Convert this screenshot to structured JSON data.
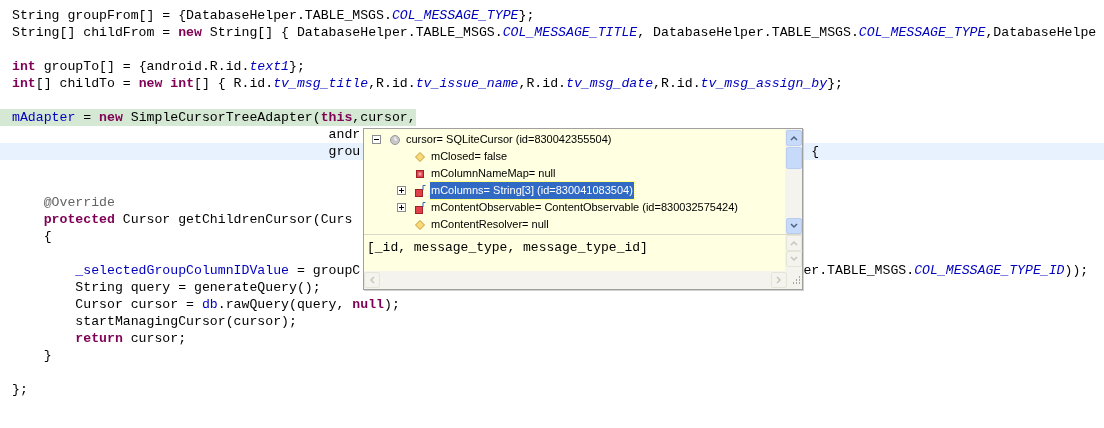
{
  "editor": {
    "lines": [
      {
        "kind": "code",
        "tokens": [
          {
            "text": "String groupFrom[] = {DatabaseHelper.TABLE_MSGS.",
            "kind": "plain"
          },
          {
            "text": "COL_MESSAGE_TYPE",
            "kind": "static"
          },
          {
            "text": "};",
            "kind": "plain"
          }
        ]
      },
      {
        "kind": "code",
        "tokens": [
          {
            "text": "String[] childFrom = ",
            "kind": "plain"
          },
          {
            "text": "new",
            "kind": "keyword"
          },
          {
            "text": " String[] { DatabaseHelper.TABLE_MSGS.",
            "kind": "plain"
          },
          {
            "text": "COL_MESSAGE_TITLE",
            "kind": "static"
          },
          {
            "text": ", DatabaseHelper.TABLE_MSGS.",
            "kind": "plain"
          },
          {
            "text": "COL_MESSAGE_TYPE",
            "kind": "static"
          },
          {
            "text": ",DatabaseHelpe",
            "kind": "plain"
          }
        ]
      },
      {
        "kind": "blank"
      },
      {
        "kind": "code",
        "tokens": [
          {
            "text": "int",
            "kind": "keyword"
          },
          {
            "text": " groupTo[] = {android.R.id.",
            "kind": "plain"
          },
          {
            "text": "text1",
            "kind": "static"
          },
          {
            "text": "};",
            "kind": "plain"
          }
        ]
      },
      {
        "kind": "code",
        "tokens": [
          {
            "text": "int",
            "kind": "keyword"
          },
          {
            "text": "[] childTo = ",
            "kind": "plain"
          },
          {
            "text": "new",
            "kind": "keyword"
          },
          {
            "text": " int",
            "kind": "keyword"
          },
          {
            "text": "[] { R.id.",
            "kind": "plain"
          },
          {
            "text": "tv_msg_title",
            "kind": "static"
          },
          {
            "text": ",R.id.",
            "kind": "plain"
          },
          {
            "text": "tv_issue_name",
            "kind": "static"
          },
          {
            "text": ",R.id.",
            "kind": "plain"
          },
          {
            "text": "tv_msg_date",
            "kind": "static"
          },
          {
            "text": ",R.id.",
            "kind": "plain"
          },
          {
            "text": "tv_msg_assign_by",
            "kind": "static"
          },
          {
            "text": "};",
            "kind": "plain"
          }
        ]
      },
      {
        "kind": "blank"
      },
      {
        "kind": "marked",
        "tokens": [
          {
            "text": "mAdapter",
            "kind": "field"
          },
          {
            "text": " = ",
            "kind": "plain"
          },
          {
            "text": "new",
            "kind": "keyword"
          },
          {
            "text": " SimpleCursorTreeAdapter(",
            "kind": "plain"
          },
          {
            "text": "this",
            "kind": "keyword"
          },
          {
            "text": ",cursor,",
            "kind": "plain"
          }
        ]
      },
      {
        "kind": "code",
        "tokens": [
          {
            "text": "                                        andr",
            "kind": "plain"
          }
        ]
      },
      {
        "kind": "current",
        "tokens": [
          {
            "text": "                                        grou",
            "kind": "plain"
          }
        ],
        "after": [
          {
            "text": " {",
            "kind": "plain"
          }
        ]
      },
      {
        "kind": "blank"
      },
      {
        "kind": "blank"
      },
      {
        "kind": "code",
        "tokens": [
          {
            "text": "    @Override",
            "kind": "annotation"
          }
        ]
      },
      {
        "kind": "code",
        "tokens": [
          {
            "text": "    protected",
            "kind": "keyword"
          },
          {
            "text": " Cursor getChildrenCursor(Curs",
            "kind": "plain"
          }
        ]
      },
      {
        "kind": "code",
        "tokens": [
          {
            "text": "    {",
            "kind": "plain"
          }
        ]
      },
      {
        "kind": "blank"
      },
      {
        "kind": "code",
        "tokens": [
          {
            "text": "        _selectedGroupColumnIDValue",
            "kind": "field"
          },
          {
            "text": " = groupC",
            "kind": "plain"
          }
        ],
        "after": [
          {
            "text": "er.TABLE_MSGS.",
            "kind": "plain"
          },
          {
            "text": "COL_MESSAGE_TYPE_ID",
            "kind": "static"
          },
          {
            "text": "));",
            "kind": "plain"
          }
        ]
      },
      {
        "kind": "code",
        "tokens": [
          {
            "text": "        String query = generateQuery();",
            "kind": "plain"
          }
        ]
      },
      {
        "kind": "code",
        "tokens": [
          {
            "text": "        Cursor cursor = ",
            "kind": "plain"
          },
          {
            "text": "db",
            "kind": "field"
          },
          {
            "text": ".rawQuery(query, ",
            "kind": "plain"
          },
          {
            "text": "null",
            "kind": "keyword"
          },
          {
            "text": ");",
            "kind": "plain"
          }
        ]
      },
      {
        "kind": "code",
        "tokens": [
          {
            "text": "        startManagingCursor(cursor);",
            "kind": "plain"
          }
        ]
      },
      {
        "kind": "code",
        "tokens": [
          {
            "text": "        return",
            "kind": "keyword"
          },
          {
            "text": " cursor;",
            "kind": "plain"
          }
        ]
      },
      {
        "kind": "code",
        "tokens": [
          {
            "text": "    }",
            "kind": "plain"
          }
        ]
      },
      {
        "kind": "blank"
      },
      {
        "kind": "code",
        "tokens": [
          {
            "text": "};",
            "kind": "plain"
          }
        ]
      }
    ]
  },
  "inspector": {
    "tree": [
      {
        "label": "cursor= SQLiteCursor  (id=830042355504)",
        "kind": "local",
        "expanded": true,
        "selected": false,
        "children": [
          {
            "label": "mClosed= false",
            "kind": "protected",
            "selected": false
          },
          {
            "label": "mColumnNameMap= null",
            "kind": "private",
            "selected": false
          },
          {
            "label": "mColumns= String[3]  (id=830041083504)",
            "kind": "private-final",
            "expanded": false,
            "selected": true
          },
          {
            "label": "mContentObservable= ContentObservable  (id=830032575424)",
            "kind": "private-final",
            "expanded": false,
            "selected": false
          },
          {
            "label": "mContentResolver= null",
            "kind": "protected",
            "selected": false
          }
        ]
      }
    ],
    "detail": "[_id, message_type, message_type_id]"
  }
}
